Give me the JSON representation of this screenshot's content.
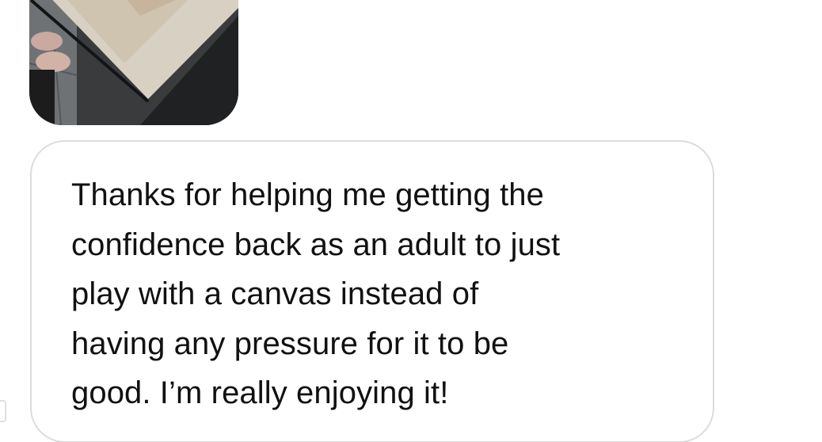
{
  "conversation": {
    "photo_message": {
      "content": "shared-photo"
    },
    "text_message": {
      "lines": [
        "Thanks for helping me getting the",
        "confidence back as an adult to just",
        "play with a canvas instead of",
        "having any pressure for it to be",
        "good. I’m really enjoying it!"
      ]
    }
  },
  "colors": {
    "background": "#ffffff",
    "bubble_border": "#dcdcdc",
    "text": "#111111"
  }
}
